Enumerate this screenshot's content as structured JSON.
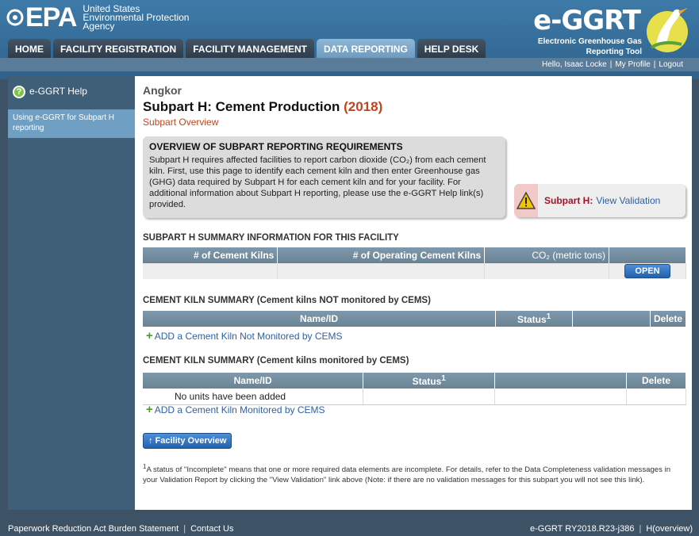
{
  "agency": {
    "logo_word": "EPA",
    "line1": "United States",
    "line2": "Environmental Protection",
    "line3": "Agency"
  },
  "app": {
    "logo_title": "e-GGRT",
    "logo_sub": "Electronic Greenhouse Gas Reporting Tool"
  },
  "nav": {
    "tabs": [
      "HOME",
      "FACILITY REGISTRATION",
      "FACILITY MANAGEMENT",
      "DATA REPORTING",
      "HELP DESK"
    ],
    "active": "DATA REPORTING"
  },
  "userbar": {
    "greeting": "Hello, Isaac Locke",
    "profile": "My Profile",
    "logout": "Logout"
  },
  "sidebar": {
    "help_title": "e-GGRT Help",
    "help_link": "Using e-GGRT for Subpart H reporting"
  },
  "page": {
    "facility": "Angkor",
    "title": "Subpart H: Cement Production",
    "year": "(2018)",
    "subtitle": "Subpart Overview"
  },
  "overview": {
    "heading": "OVERVIEW OF SUBPART REPORTING REQUIREMENTS",
    "body": "Subpart H requires affected facilities to report carbon dioxide (CO₂) from each cement kiln. First, use this page to identify each cement kiln and then enter Greenhouse gas (GHG) data required by Subpart H for each cement kiln and for your facility. For additional information about Subpart H reporting, please use the e-GGRT Help link(s) provided."
  },
  "validation": {
    "label": "Subpart H:",
    "link": "View Validation"
  },
  "summary": {
    "heading": "SUBPART H SUMMARY INFORMATION FOR THIS FACILITY",
    "columns": [
      "# of Cement Kilns",
      "# of Operating Cement Kilns",
      "CO₂ (metric tons)"
    ],
    "open_button": "OPEN"
  },
  "kilns_not_cems": {
    "heading": "CEMENT KILN SUMMARY (Cement kilns NOT monitored by CEMS)",
    "columns": [
      "Name/ID",
      "Status",
      "Delete"
    ],
    "status_sup": "1",
    "add_link": "ADD a Cement Kiln Not Monitored by CEMS"
  },
  "kilns_cems": {
    "heading": "CEMENT KILN SUMMARY (Cement kilns monitored by CEMS)",
    "columns": [
      "Name/ID",
      "Status",
      "Delete"
    ],
    "status_sup": "1",
    "empty_text": "No units have been added",
    "add_link": "ADD a Cement Kiln Monitored by CEMS"
  },
  "facility_overview_button": "Facility Overview",
  "footnote": {
    "marker": "1",
    "text": "A status of \"Incomplete\" means that one or more required data elements are incomplete. For details, refer to the Data Completeness validation messages in your Validation Report by clicking the \"View Validation\" link above (Note: if there are no validation messages for this subpart you will not see this link)."
  },
  "footer": {
    "left_links": [
      "Paperwork Reduction Act Burden Statement",
      "Contact Us"
    ],
    "version": "e-GGRT RY2018.R23-j386",
    "page_code": "H(overview)"
  },
  "colors": {
    "header_blue": "#356c98",
    "accent_red": "#c0451a",
    "link_blue": "#2d5fa6",
    "table_header": "#7590a3"
  }
}
